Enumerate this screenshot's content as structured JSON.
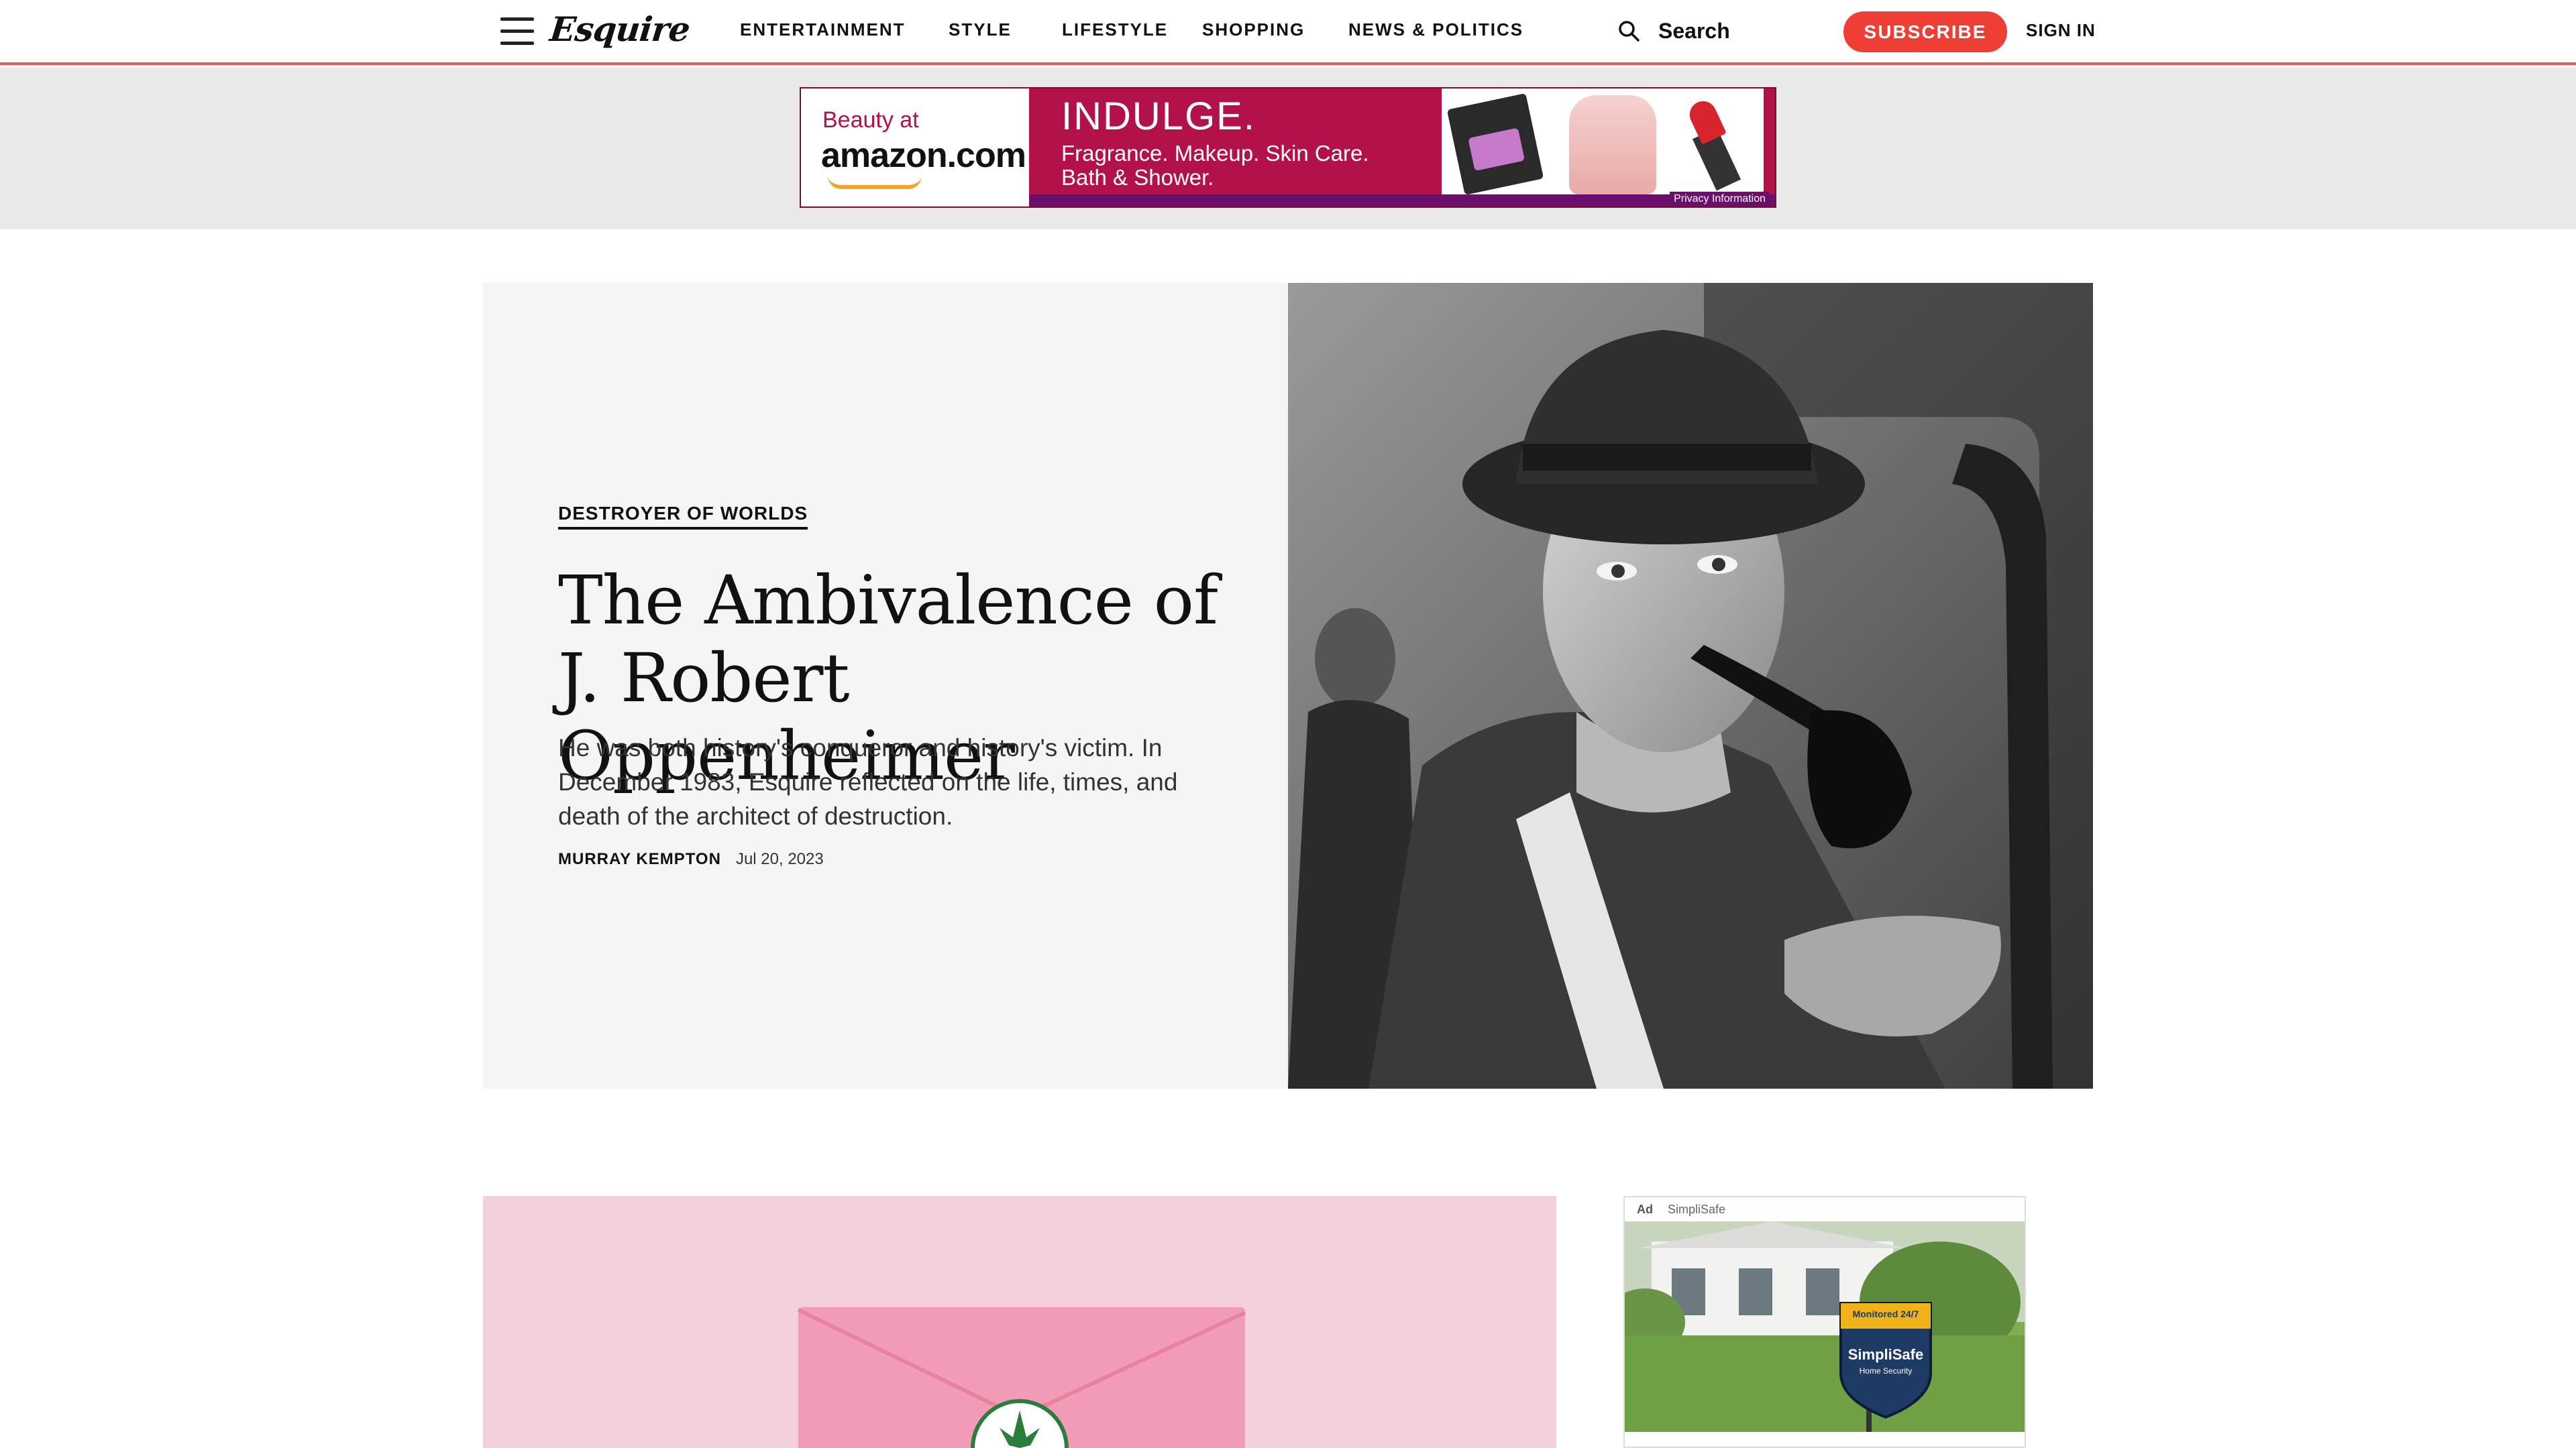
{
  "nav": {
    "logo": "Esquire",
    "links": [
      "ENTERTAINMENT",
      "STYLE",
      "LIFESTYLE",
      "SHOPPING",
      "NEWS & POLITICS"
    ],
    "search_label": "Search",
    "subscribe_label": "SUBSCRIBE",
    "signin_label": "SIGN IN",
    "accent_color": "#ef3f35"
  },
  "banner_ad": {
    "beauty_at": "Beauty at",
    "amazon": "amazon.com",
    "headline": "INDULGE.",
    "line1": "Fragrance. Makeup. Skin Care.",
    "line2": "Bath & Shower.",
    "privacy": "Privacy Information",
    "brand_color": "#b2114a"
  },
  "hero": {
    "kicker": "DESTROYER OF WORLDS",
    "headline": "The Ambivalence of J. Robert Oppenheimer",
    "dek": "He was both history's conqueror and history's victim. In December 1983, Esquire reflected on the life, times, and death of the architect of destruction.",
    "author": "MURRAY KEMPTON",
    "date": "Jul 20, 2023"
  },
  "side_ad": {
    "tag": "Ad",
    "sponsor": "SimpliSafe",
    "badge_top": "Monitored 24/7",
    "badge_brand": "SimpliSafe",
    "badge_sub": "Home Security"
  }
}
